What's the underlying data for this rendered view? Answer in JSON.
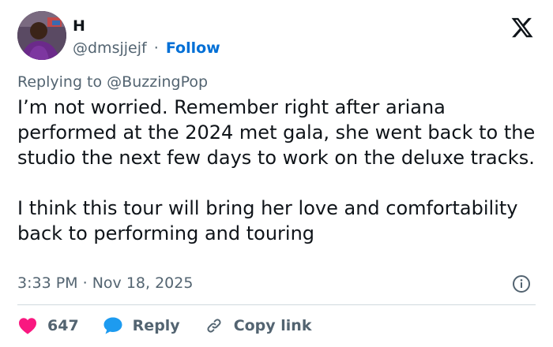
{
  "author": {
    "name": "H",
    "handle": "@dmsjjejf",
    "separator": "·",
    "follow_label": "Follow"
  },
  "reply_context": {
    "prefix": "Replying to",
    "mention": "@BuzzingPop"
  },
  "tweet": {
    "paragraphs": [
      "I’m not worried. Remember right after ariana performed at the 2024 met gala, she went back to the studio the next few days to work on the deluxe tracks.",
      "I think this tour will bring her love and comfortability back to performing and touring"
    ],
    "time": "3:33 PM",
    "separator": "·",
    "date": "Nov 18, 2025"
  },
  "actions": {
    "like_count": "647",
    "reply_label": "Reply",
    "copy_link_label": "Copy link"
  },
  "colors": {
    "like": "#f91880",
    "reply": "#1d9bf0",
    "follow": "#006fd6",
    "muted": "#536471",
    "text": "#0f1419"
  },
  "icons": [
    "x-logo-icon",
    "info-icon",
    "heart-icon",
    "reply-bubble-icon",
    "link-icon"
  ]
}
